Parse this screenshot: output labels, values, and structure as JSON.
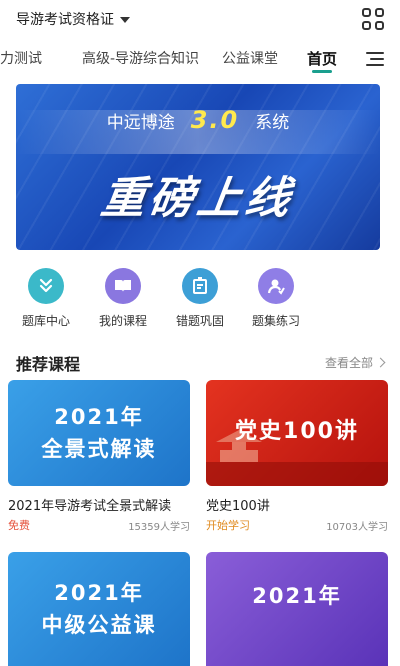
{
  "header": {
    "exam_name": "导游考试资格证"
  },
  "tabs": [
    {
      "label": "能力测试"
    },
    {
      "label": "高级-导游综合知识"
    },
    {
      "label": "公益课堂"
    },
    {
      "label": "首页"
    }
  ],
  "banner": {
    "brand": "中远博途",
    "version": "3.0",
    "suffix": "系统",
    "headline": "重磅上线"
  },
  "quick_links": [
    {
      "label": "题库中心",
      "icon": "question-bank-icon",
      "color": "#3bb9c9"
    },
    {
      "label": "我的课程",
      "icon": "book-icon",
      "color": "#8a77e0"
    },
    {
      "label": "错题巩固",
      "icon": "error-review-icon",
      "color": "#3d9fd6"
    },
    {
      "label": "题集练习",
      "icon": "practice-set-icon",
      "color": "#8f7ee6"
    }
  ],
  "section": {
    "title": "推荐课程",
    "see_all": "查看全部"
  },
  "courses": [
    {
      "thumb_line1": "2021年",
      "thumb_line2": "全景式解读",
      "title": "2021年导游考试全景式解读",
      "price": "免费",
      "price_color": "#e5533d",
      "count": "15359人学习"
    },
    {
      "thumb_line1": "党史100讲",
      "thumb_line2": "",
      "title": "党史100讲",
      "price": "开始学习",
      "price_color": "#e08a1e",
      "count": "10703人学习"
    },
    {
      "thumb_line1": "2021年",
      "thumb_line2": "中级公益课"
    },
    {
      "thumb_line1": "2021年",
      "thumb_line2": ""
    }
  ],
  "colors": {
    "accent": "#1a9f8e",
    "price_free": "#e5533d",
    "price_start": "#e08a1e"
  }
}
